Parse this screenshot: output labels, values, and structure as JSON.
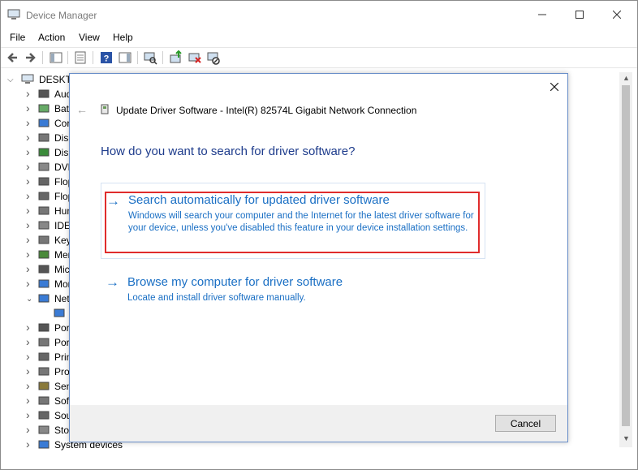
{
  "window": {
    "title": "Device Manager"
  },
  "menu": [
    "File",
    "Action",
    "View",
    "Help"
  ],
  "toolbar_icons": [
    "back-arrow-icon",
    "forward-arrow-icon",
    "show-hide-tree-icon",
    "properties-icon",
    "help-icon",
    "action-pane-icon",
    "scan-hardware-icon",
    "update-driver-icon",
    "uninstall-device-icon",
    "disable-device-icon"
  ],
  "tree": {
    "root": "DESKTO",
    "items": [
      {
        "label": "Aud",
        "icon": "audio-icon",
        "expanded": false
      },
      {
        "label": "Batt",
        "icon": "battery-icon",
        "expanded": false
      },
      {
        "label": "Cor",
        "icon": "computer-icon",
        "expanded": false
      },
      {
        "label": "Disk",
        "icon": "disk-drive-icon",
        "expanded": false
      },
      {
        "label": "Disp",
        "icon": "display-adapter-icon",
        "expanded": false
      },
      {
        "label": "DVD",
        "icon": "dvd-drive-icon",
        "expanded": false
      },
      {
        "label": "Flop",
        "icon": "floppy-controller-icon",
        "expanded": false
      },
      {
        "label": "Flop",
        "icon": "floppy-drive-icon",
        "expanded": false
      },
      {
        "label": "Hun",
        "icon": "hid-icon",
        "expanded": false
      },
      {
        "label": "IDE",
        "icon": "ide-controller-icon",
        "expanded": false
      },
      {
        "label": "Key",
        "icon": "keyboard-icon",
        "expanded": false
      },
      {
        "label": "Mer",
        "icon": "memory-icon",
        "expanded": false
      },
      {
        "label": "Mic",
        "icon": "mouse-icon",
        "expanded": false
      },
      {
        "label": "Mor",
        "icon": "monitor-icon",
        "expanded": false
      },
      {
        "label": "Net",
        "icon": "network-adapter-icon",
        "expanded": true
      },
      {
        "label": "",
        "icon": "network-card-icon",
        "child": true
      },
      {
        "label": "Por",
        "icon": "portable-device-icon",
        "expanded": false
      },
      {
        "label": "Por",
        "icon": "port-icon",
        "expanded": false
      },
      {
        "label": "Prin",
        "icon": "print-queue-icon",
        "expanded": false
      },
      {
        "label": "Pro",
        "icon": "processor-icon",
        "expanded": false
      },
      {
        "label": "Sen",
        "icon": "sensor-icon",
        "expanded": false
      },
      {
        "label": "Sof",
        "icon": "software-device-icon",
        "expanded": false
      },
      {
        "label": "Sou",
        "icon": "sound-icon",
        "expanded": false
      },
      {
        "label": "Sto",
        "icon": "storage-icon",
        "expanded": false
      },
      {
        "label": "System devices",
        "icon": "system-devices-icon",
        "expanded": false
      }
    ]
  },
  "dialog": {
    "title": "Update Driver Software - Intel(R) 82574L Gigabit Network Connection",
    "question": "How do you want to search for driver software?",
    "option_auto": {
      "arrow": "→",
      "title": "Search automatically for updated driver software",
      "description": "Windows will search your computer and the Internet for the latest driver software for your device, unless you've disabled this feature in your device installation settings."
    },
    "option_browse": {
      "arrow": "→",
      "title": "Browse my computer for driver software",
      "description": "Locate and install driver software manually."
    },
    "cancel_label": "Cancel"
  },
  "colors": {
    "link": "#1a6fc4",
    "heading": "#1e3c8c",
    "highlight": "#e02c2c"
  }
}
